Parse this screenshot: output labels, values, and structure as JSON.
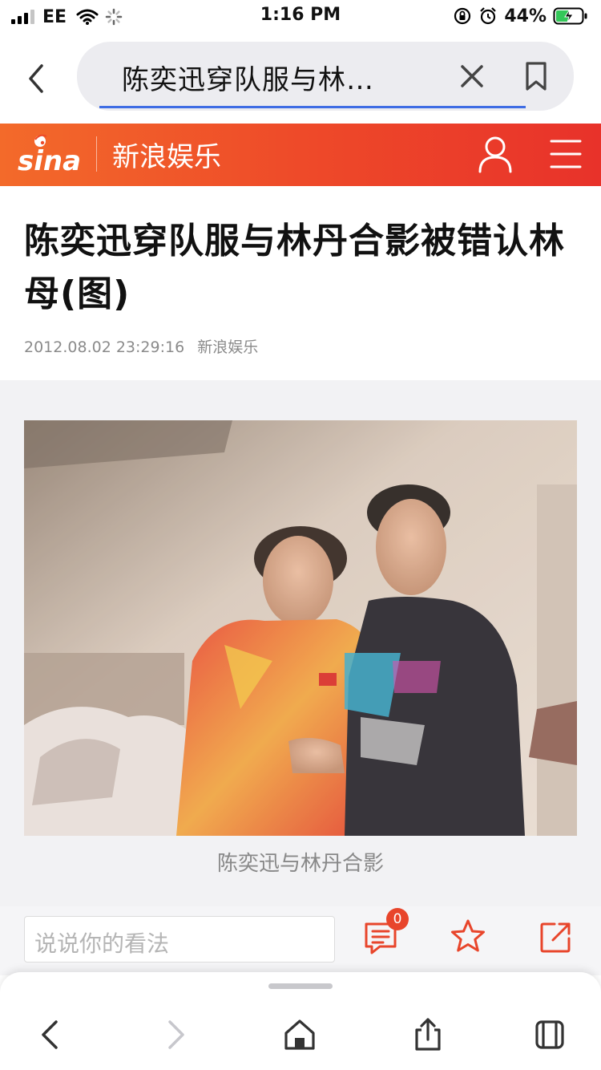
{
  "status_bar": {
    "carrier": "EE",
    "time": "1:16 PM",
    "battery_percent": "44%"
  },
  "browser": {
    "url_text": "陈奕迅穿队服与林…",
    "icons": [
      "back-chevron-icon",
      "clear-icon",
      "bookmark-icon"
    ],
    "progress_color": "#3f6de4"
  },
  "site_header": {
    "logo": "sina",
    "channel": "新浪娱乐",
    "icons": [
      "user-icon",
      "menu-icon"
    ],
    "brand_color": "#e8452b"
  },
  "article": {
    "title": "陈奕迅穿队服与林丹合影被错认林母(图)",
    "timestamp": "2012.08.02 23:29:16",
    "source": "新浪娱乐",
    "image_caption": "陈奕迅与林丹合影"
  },
  "comment_bar": {
    "placeholder": "说说你的看法",
    "comment_count": "0",
    "icons": [
      "comment-icon",
      "favorite-star-icon",
      "share-icon"
    ]
  },
  "toolbar": {
    "icons": [
      "back-icon",
      "forward-icon",
      "home-icon",
      "share-upload-icon",
      "tabs-icon"
    ]
  }
}
